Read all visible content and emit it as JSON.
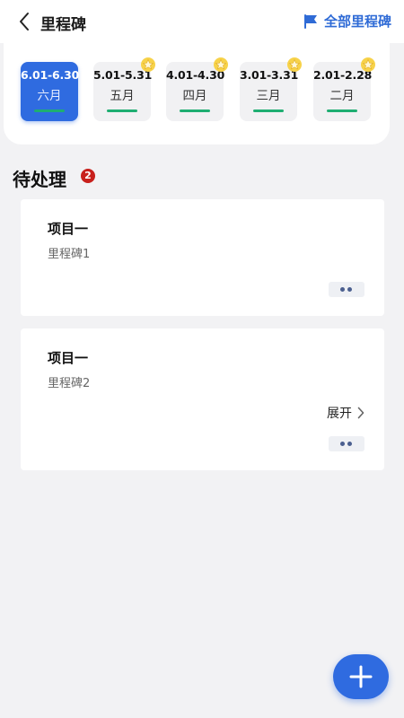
{
  "header": {
    "title": "里程碑",
    "all_milestones_label": "全部里程碑",
    "accent_color": "#2f6bd6"
  },
  "months": [
    {
      "range": "6.01-6.30",
      "name": "六月",
      "active": true,
      "starred": false
    },
    {
      "range": "5.01-5.31",
      "name": "五月",
      "active": false,
      "starred": true
    },
    {
      "range": "4.01-4.30",
      "name": "四月",
      "active": false,
      "starred": true
    },
    {
      "range": "3.01-3.31",
      "name": "三月",
      "active": false,
      "starred": true
    },
    {
      "range": "2.01-2.28",
      "name": "二月",
      "active": false,
      "starred": true
    }
  ],
  "pending": {
    "title": "待处理",
    "count": "2"
  },
  "tasks": [
    {
      "title": "项目一",
      "subtitle": "里程碑1"
    },
    {
      "title": "项目一",
      "subtitle": "里程碑2",
      "expand_label": "展开"
    }
  ],
  "icons": {
    "back": "chevron-left-icon",
    "flag": "flag-icon",
    "star": "star-icon",
    "more": "more-dots-icon",
    "expand": "chevron-right-icon",
    "add": "plus-icon"
  }
}
